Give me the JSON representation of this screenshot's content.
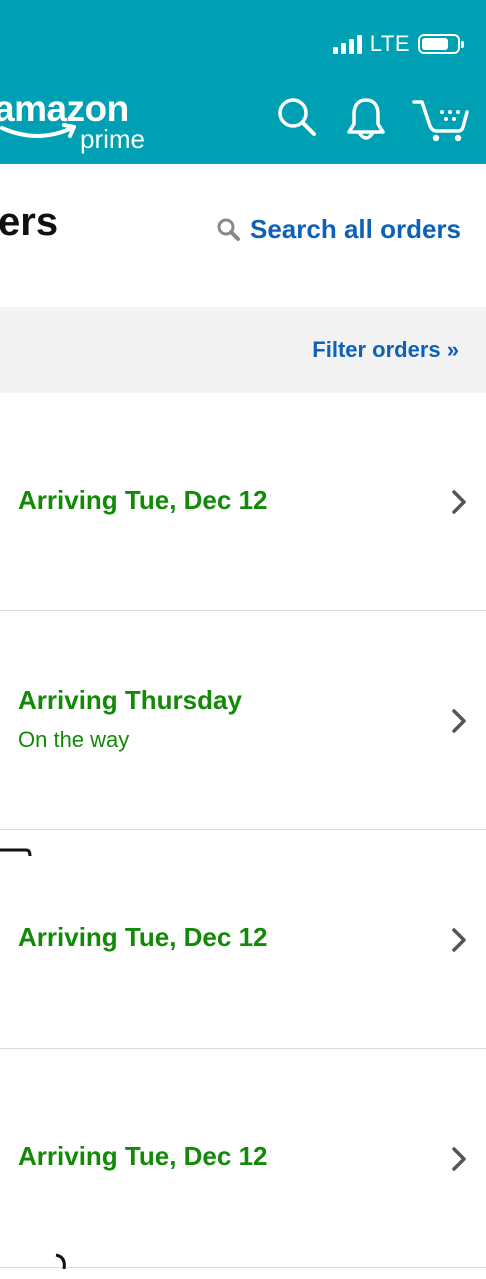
{
  "status_bar": {
    "network": "LTE"
  },
  "header": {
    "logo_amazon": "amazon",
    "logo_prime": "prime",
    "icons": [
      "search-icon",
      "bell-icon",
      "cart-icon"
    ],
    "background": "#00a0b4"
  },
  "page": {
    "title": "ers",
    "search_link": "Search all orders",
    "filter_link": "Filter orders »"
  },
  "orders": [
    {
      "status": "Arriving Tue, Dec 12",
      "detail": ""
    },
    {
      "status": "Arriving Thursday",
      "detail": "On the way"
    },
    {
      "status": "Arriving Tue, Dec 12",
      "detail": ""
    },
    {
      "status": "Arriving Tue, Dec 12",
      "detail": ""
    }
  ],
  "colors": {
    "link": "#0e62b6",
    "arriving": "#138a07",
    "filter_bar": "#f3f3f3"
  }
}
